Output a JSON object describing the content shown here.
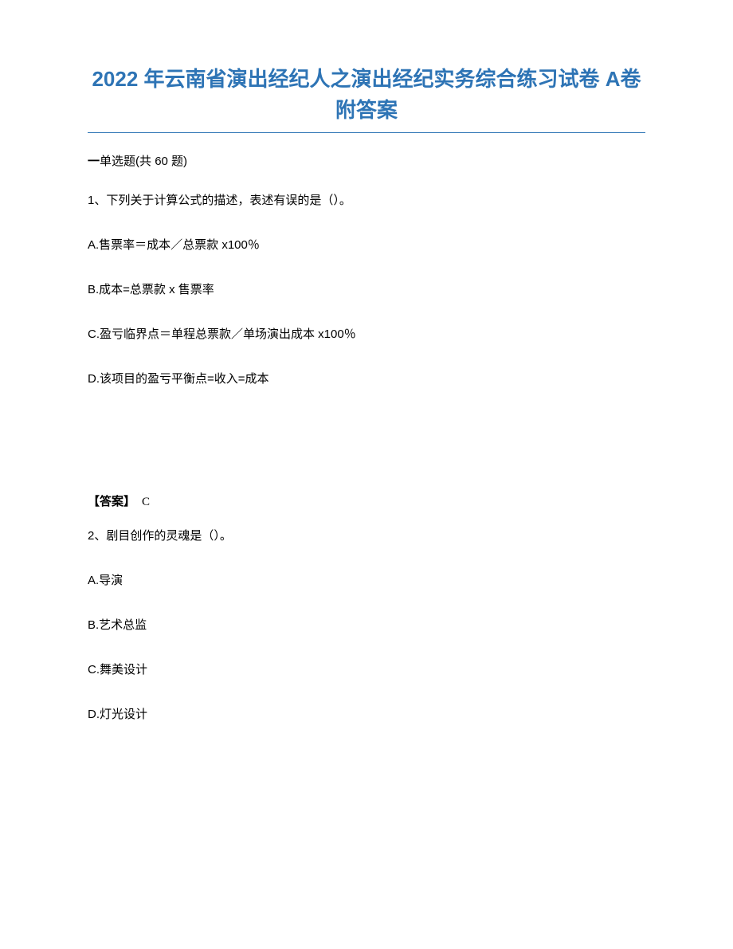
{
  "title": "2022 年云南省演出经纪人之演出经纪实务综合练习试卷 A卷附答案",
  "section_header_prefix": "一",
  "section_header_type": "单选题",
  "section_header_count_open": "(共 ",
  "section_header_count_num": "60",
  "section_header_count_close": " 题)",
  "questions": [
    {
      "number": "1、",
      "text": "下列关于计算公式的描述，表述有误的是（）。",
      "options": {
        "A": "A.售票率＝成本／总票款 x100％",
        "B": "B.成本=总票款 x 售票率",
        "C": "C.盈亏临界点＝单程总票款／单场演出成本 x100％",
        "D": "D.该项目的盈亏平衡点=收入=成本"
      },
      "answer_label": "【答案】",
      "answer_value": "C"
    },
    {
      "number": "2、",
      "text": "剧目创作的灵魂是（）。",
      "options": {
        "A": "A.导演",
        "B": "B.艺术总监",
        "C": "C.舞美设计",
        "D": "D.灯光设计"
      }
    }
  ]
}
